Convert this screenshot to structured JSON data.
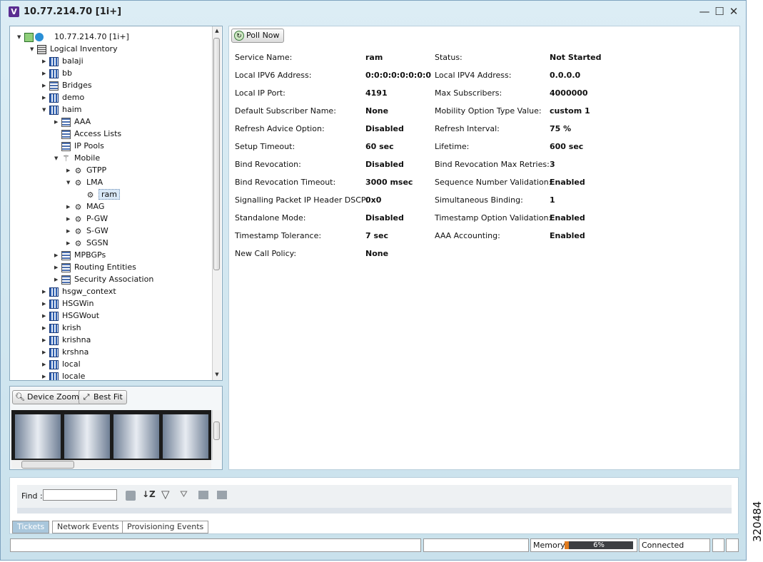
{
  "window": {
    "title": "10.77.214.70 [1i+]",
    "app_icon": "V",
    "minimize": "—",
    "maximize": "☐",
    "close": "✕"
  },
  "tree": {
    "root": "10.77.214.70 [1i+]",
    "items": [
      {
        "label": "Logical Inventory",
        "level": 1,
        "arrow": "down",
        "icon": "logical-inventory-icon"
      },
      {
        "label": "balaji",
        "level": 2,
        "arrow": "right",
        "icon": "context-icon"
      },
      {
        "label": "bb",
        "level": 2,
        "arrow": "right",
        "icon": "context-icon"
      },
      {
        "label": "Bridges",
        "level": 2,
        "arrow": "right",
        "icon": "list-icon"
      },
      {
        "label": "demo",
        "level": 2,
        "arrow": "right",
        "icon": "context-icon"
      },
      {
        "label": "haim",
        "level": 2,
        "arrow": "down",
        "icon": "context-icon"
      },
      {
        "label": "AAA",
        "level": 3,
        "arrow": "right",
        "icon": "list-icon"
      },
      {
        "label": "Access Lists",
        "level": 3,
        "arrow": "",
        "icon": "list-icon"
      },
      {
        "label": "IP Pools",
        "level": 3,
        "arrow": "",
        "icon": "list-icon"
      },
      {
        "label": "Mobile",
        "level": 3,
        "arrow": "down",
        "icon": "antenna-icon"
      },
      {
        "label": "GTPP",
        "level": 4,
        "arrow": "right",
        "icon": "gear-icon"
      },
      {
        "label": "LMA",
        "level": 4,
        "arrow": "down",
        "icon": "gear-icon"
      },
      {
        "label": "ram",
        "level": 5,
        "arrow": "",
        "icon": "gear-icon",
        "selected": true
      },
      {
        "label": "MAG",
        "level": 4,
        "arrow": "right",
        "icon": "gear-icon"
      },
      {
        "label": "P-GW",
        "level": 4,
        "arrow": "right",
        "icon": "gear-icon"
      },
      {
        "label": "S-GW",
        "level": 4,
        "arrow": "right",
        "icon": "gear-icon"
      },
      {
        "label": "SGSN",
        "level": 4,
        "arrow": "right",
        "icon": "gear-icon"
      },
      {
        "label": "MPBGPs",
        "level": 3,
        "arrow": "right",
        "icon": "list-icon"
      },
      {
        "label": "Routing Entities",
        "level": 3,
        "arrow": "right",
        "icon": "list-icon"
      },
      {
        "label": "Security Association",
        "level": 3,
        "arrow": "right",
        "icon": "list-icon"
      },
      {
        "label": "hsgw_context",
        "level": 2,
        "arrow": "right",
        "icon": "context-icon"
      },
      {
        "label": "HSGWin",
        "level": 2,
        "arrow": "right",
        "icon": "context-icon"
      },
      {
        "label": "HSGWout",
        "level": 2,
        "arrow": "right",
        "icon": "context-icon"
      },
      {
        "label": "krish",
        "level": 2,
        "arrow": "right",
        "icon": "context-icon"
      },
      {
        "label": "krishna",
        "level": 2,
        "arrow": "right",
        "icon": "context-icon"
      },
      {
        "label": "krshna",
        "level": 2,
        "arrow": "right",
        "icon": "context-icon"
      },
      {
        "label": "local",
        "level": 2,
        "arrow": "right",
        "icon": "context-icon"
      },
      {
        "label": "locale",
        "level": 2,
        "arrow": "right",
        "icon": "context-icon"
      }
    ]
  },
  "zoom": {
    "device_zoom": "Device Zoom",
    "best_fit": "Best Fit"
  },
  "details": {
    "poll_now": "Poll Now",
    "left": [
      {
        "label": "Service Name:",
        "value": "ram"
      },
      {
        "label": "Local IPV6 Address:",
        "value": "0:0:0:0:0:0:0:0"
      },
      {
        "label": "Local IP Port:",
        "value": "4191"
      },
      {
        "label": "Default Subscriber Name:",
        "value": "None"
      },
      {
        "label": "Refresh Advice Option:",
        "value": "Disabled"
      },
      {
        "label": "Setup Timeout:",
        "value": "60 sec"
      },
      {
        "label": "Bind Revocation:",
        "value": "Disabled"
      },
      {
        "label": "Bind Revocation Timeout:",
        "value": "3000 msec"
      },
      {
        "label": "Signalling Packet IP Header DSCP:",
        "value": "0x0"
      },
      {
        "label": "Standalone Mode:",
        "value": "Disabled"
      },
      {
        "label": "Timestamp Tolerance:",
        "value": "7 sec"
      },
      {
        "label": "New Call Policy:",
        "value": "None"
      }
    ],
    "right": [
      {
        "label": "Status:",
        "value": "Not Started"
      },
      {
        "label": "Local IPV4 Address:",
        "value": "0.0.0.0"
      },
      {
        "label": "Max Subscribers:",
        "value": "4000000"
      },
      {
        "label": "Mobility Option Type Value:",
        "value": "custom 1"
      },
      {
        "label": "Refresh Interval:",
        "value": "75 %"
      },
      {
        "label": "Lifetime:",
        "value": "600 sec"
      },
      {
        "label": "Bind Revocation Max Retries:",
        "value": "3"
      },
      {
        "label": "Sequence Number Validation:",
        "value": "Enabled"
      },
      {
        "label": "Simultaneous Binding:",
        "value": "1"
      },
      {
        "label": "Timestamp Option Validation:",
        "value": "Enabled"
      },
      {
        "label": "AAA Accounting:",
        "value": "Enabled"
      }
    ]
  },
  "events": {
    "find_label": "Find :",
    "find_value": "",
    "tabs": [
      "Tickets",
      "Network Events",
      "Provisioning Events"
    ],
    "active_tab": "Tickets"
  },
  "status": {
    "memory_label": "Memory:",
    "memory_percent": "6%",
    "memory_fraction": 0.06,
    "connection": "Connected"
  },
  "side_label": "320484"
}
